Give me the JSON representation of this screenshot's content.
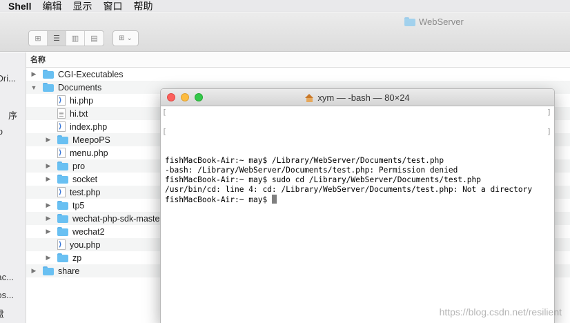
{
  "menubar": {
    "app": "Shell",
    "items": [
      "编辑",
      "显示",
      "窗口",
      "帮助"
    ]
  },
  "finder": {
    "title": "WebServer",
    "column_header": "名称",
    "sidebar_items": [
      "Dri...",
      "序",
      "p",
      "ac...",
      "os...",
      "盘"
    ],
    "rows": [
      {
        "name": "CGI-Executables",
        "kind": "folder",
        "expander": "collapsed",
        "level": 0
      },
      {
        "name": "Documents",
        "kind": "folder",
        "expander": "expanded",
        "level": 0
      },
      {
        "name": "hi.php",
        "kind": "php",
        "expander": "none",
        "level": 1
      },
      {
        "name": "hi.txt",
        "kind": "txt",
        "expander": "none",
        "level": 1
      },
      {
        "name": "index.php",
        "kind": "php",
        "expander": "none",
        "level": 1
      },
      {
        "name": "MeepoPS",
        "kind": "folder",
        "expander": "collapsed",
        "level": 1
      },
      {
        "name": "menu.php",
        "kind": "php",
        "expander": "none",
        "level": 1
      },
      {
        "name": "pro",
        "kind": "folder",
        "expander": "collapsed",
        "level": 1
      },
      {
        "name": "socket",
        "kind": "folder",
        "expander": "collapsed",
        "level": 1
      },
      {
        "name": "test.php",
        "kind": "php",
        "expander": "none",
        "level": 1
      },
      {
        "name": "tp5",
        "kind": "folder",
        "expander": "collapsed",
        "level": 1
      },
      {
        "name": "wechat-php-sdk-master",
        "kind": "folder",
        "expander": "collapsed",
        "level": 1
      },
      {
        "name": "wechat2",
        "kind": "folder",
        "expander": "collapsed",
        "level": 1
      },
      {
        "name": "you.php",
        "kind": "php",
        "expander": "none",
        "level": 1
      },
      {
        "name": "zp",
        "kind": "folder",
        "expander": "collapsed",
        "level": 1
      },
      {
        "name": "share",
        "kind": "folder",
        "expander": "collapsed",
        "level": 0
      }
    ]
  },
  "terminal": {
    "title": "xym — -bash — 80×24",
    "lines": [
      "fishMacBook-Air:~ may$ /Library/WebServer/Documents/test.php",
      "-bash: /Library/WebServer/Documents/test.php: Permission denied",
      "fishMacBook-Air:~ may$ sudo cd /Library/WebServer/Documents/test.php",
      "/usr/bin/cd: line 4: cd: /Library/WebServer/Documents/test.php: Not a directory"
    ],
    "prompt": "fishMacBook-Air:~ may$ "
  },
  "watermark": "https://blog.csdn.net/resilient",
  "colors": {
    "folder": "#69c0f2",
    "close": "#fc605c",
    "minimize": "#fdbc40",
    "maximize": "#34c84a"
  }
}
